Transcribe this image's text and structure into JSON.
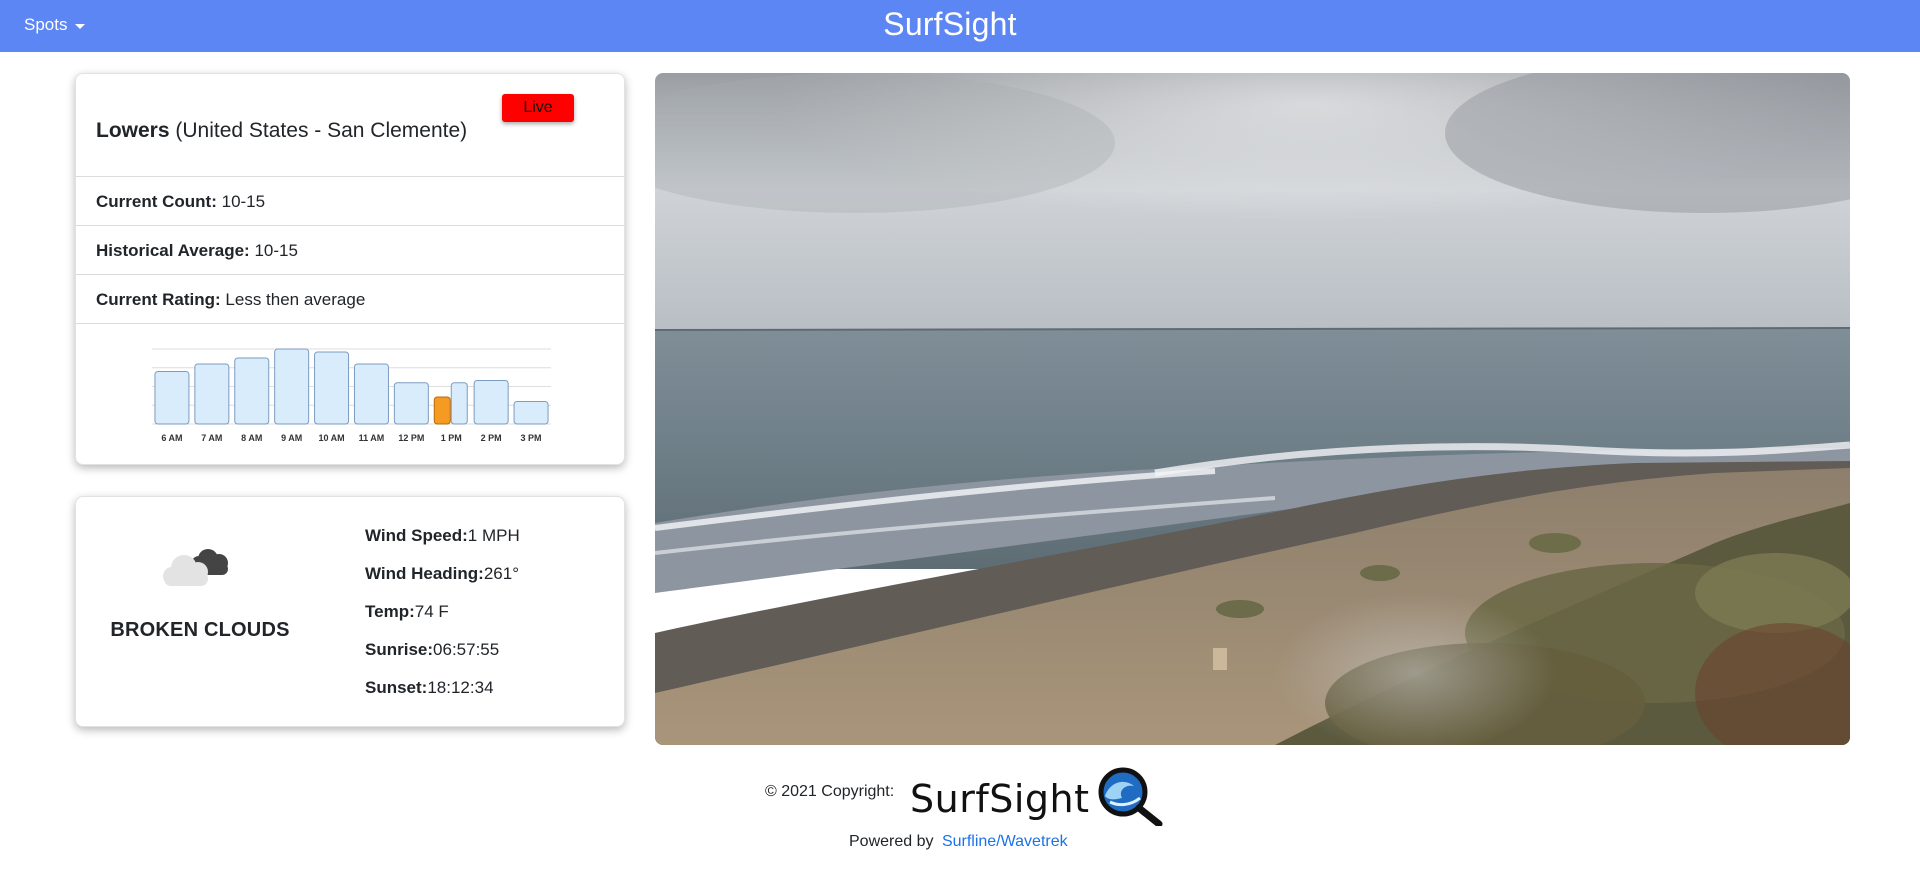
{
  "nav": {
    "dropdown_label": "Spots",
    "brand": "SurfSight"
  },
  "spot": {
    "name": "Lowers",
    "location": "(United States - San Clemente)",
    "live_badge": "Live",
    "current_count_label": "Current Count:",
    "current_count": "10-15",
    "historical_avg_label": "Historical Average:",
    "historical_avg": "10-15",
    "current_rating_label": "Current Rating:",
    "current_rating": "Less then average"
  },
  "chart_data": {
    "type": "bar",
    "categories": [
      "6 AM",
      "7 AM",
      "8 AM",
      "9 AM",
      "10 AM",
      "11 AM",
      "12 PM",
      "1 PM",
      "2 PM",
      "3 PM"
    ],
    "values": [
      7,
      8,
      8.8,
      10,
      9.6,
      8,
      5.5,
      5.5,
      5.8,
      3
    ],
    "current": {
      "category": "1 PM",
      "value": 3.6
    },
    "ylim": [
      0,
      10
    ],
    "grid": true,
    "colors": {
      "bar": "#d8ecfc",
      "bar_border": "#7c9cc0",
      "current": "#f59a23"
    }
  },
  "weather": {
    "icon": "broken-clouds-icon",
    "description": "BROKEN CLOUDS",
    "wind_speed_label": "Wind Speed:",
    "wind_speed": "1 MPH",
    "wind_heading_label": "Wind Heading:",
    "wind_heading": "261°",
    "temp_label": "Temp:",
    "temp": "74 F",
    "sunrise_label": "Sunrise:",
    "sunrise": "06:57:55",
    "sunset_label": "Sunset:",
    "sunset": "18:12:34"
  },
  "footer": {
    "copyright": "© 2021 Copyright:",
    "logo_text": "SurfSight",
    "powered_by": "Powered by",
    "link_text": "Surfline/Wavetrek"
  },
  "colors": {
    "navbar": "#5b86f4",
    "live_badge": "#ff0000",
    "link": "#1b73e8"
  }
}
